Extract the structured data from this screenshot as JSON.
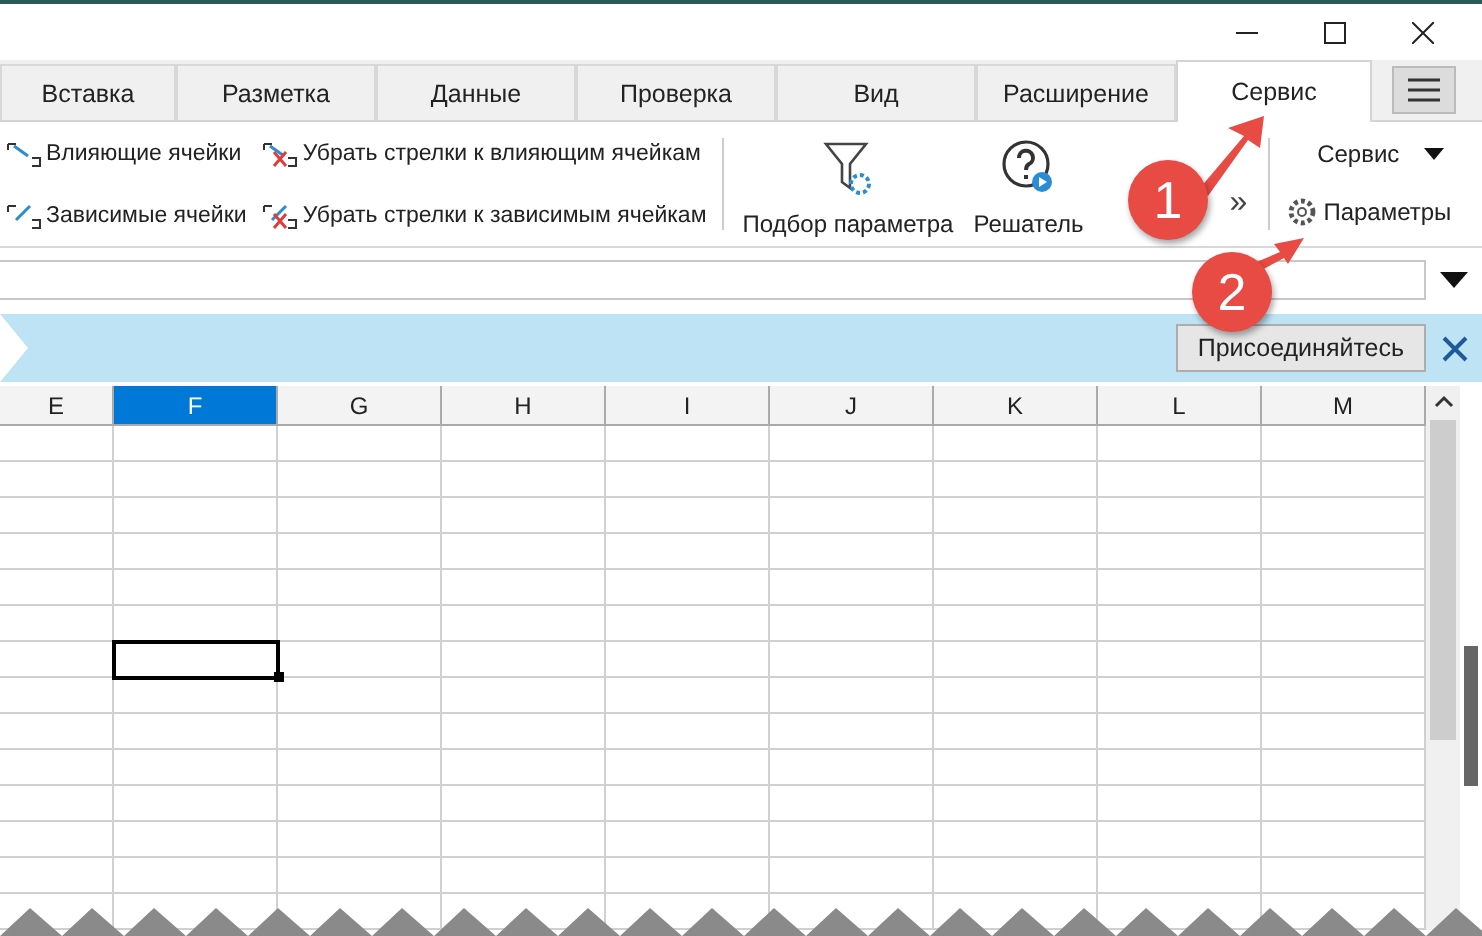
{
  "tabs": [
    {
      "label": "Вставка",
      "selected": false
    },
    {
      "label": "Разметка",
      "selected": false
    },
    {
      "label": "Данные",
      "selected": false
    },
    {
      "label": "Проверка",
      "selected": false
    },
    {
      "label": "Вид",
      "selected": false
    },
    {
      "label": "Расширение",
      "selected": false
    },
    {
      "label": "Сервис",
      "selected": true
    }
  ],
  "ribbon": {
    "small_items": [
      {
        "label": "Влияющие ячейки",
        "kind": "trace"
      },
      {
        "label": "Зависимые ячейки",
        "kind": "dependents"
      },
      {
        "label": "Убрать стрелки к влияющим ячейкам",
        "kind": "remove-trace"
      },
      {
        "label": "Убрать стрелки к зависимым ячейкам",
        "kind": "remove-dependents"
      }
    ],
    "large_items": [
      {
        "label": "Подбор параметра",
        "kind": "goal-seek"
      },
      {
        "label": "Решатель",
        "kind": "solver"
      }
    ],
    "overflow": "»",
    "tools_dropdown": "Сервис",
    "options_button": "Параметры"
  },
  "info_bar": {
    "button": "Присоединяйтесь"
  },
  "columns": [
    {
      "label": "E",
      "selected": false
    },
    {
      "label": "F",
      "selected": true
    },
    {
      "label": "G",
      "selected": false
    },
    {
      "label": "H",
      "selected": false
    },
    {
      "label": "I",
      "selected": false
    },
    {
      "label": "J",
      "selected": false
    },
    {
      "label": "K",
      "selected": false
    },
    {
      "label": "L",
      "selected": false
    },
    {
      "label": "M",
      "selected": false
    }
  ],
  "callouts": [
    "1",
    "2"
  ]
}
